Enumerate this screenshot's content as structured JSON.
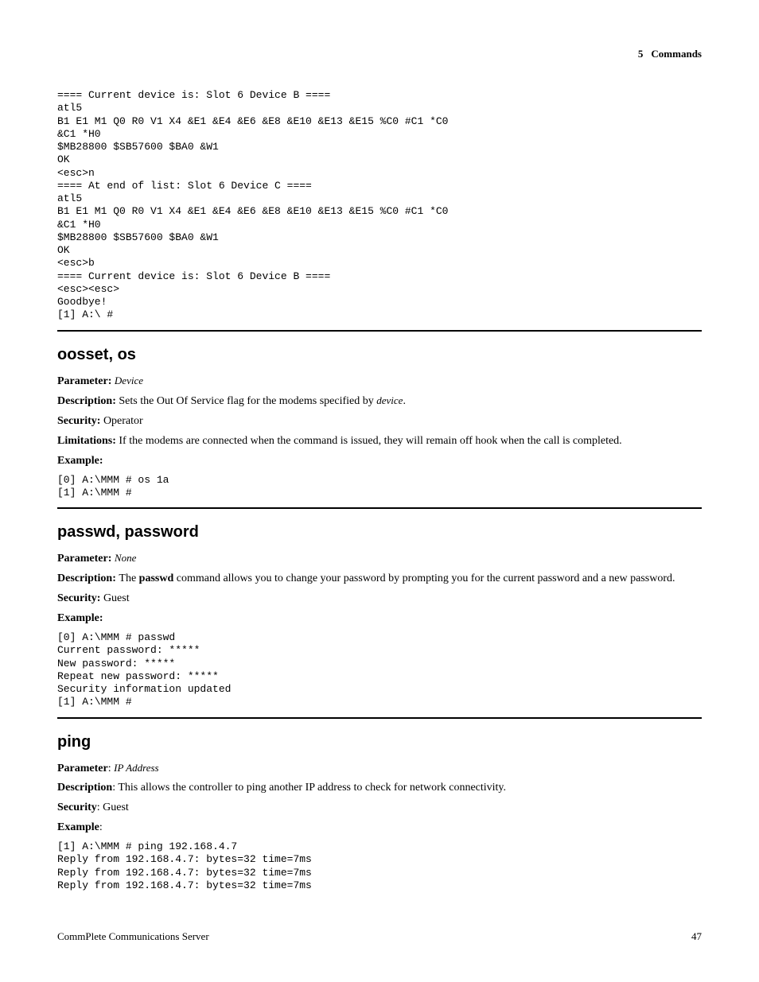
{
  "header": {
    "section_number": "5",
    "section_title": "Commands"
  },
  "intro_code": "==== Current device is: Slot 6 Device B ====\natl5\nB1 E1 M1 Q0 R0 V1 X4 &E1 &E4 &E6 &E8 &E10 &E13 &E15 %C0 #C1 *C0\n&C1 *H0\n$MB28800 $SB57600 $BA0 &W1\nOK\n<esc>n\n==== At end of list: Slot 6 Device C ====\natl5\nB1 E1 M1 Q0 R0 V1 X4 &E1 &E4 &E6 &E8 &E10 &E13 &E15 %C0 #C1 *C0\n&C1 *H0\n$MB28800 $SB57600 $BA0 &W1\nOK\n<esc>b\n==== Current device is: Slot 6 Device B ====\n<esc><esc>\nGoodbye!\n[1] A:\\ #",
  "sections": {
    "oosset": {
      "title": "oosset, os",
      "param_label": "Parameter: ",
      "param_value": "Device",
      "desc_label": "Description: ",
      "desc_pre": "Sets the Out Of Service flag for the modems specified by ",
      "desc_post_ital": "device",
      "desc_end": ".",
      "sec_label": "Security: ",
      "sec_value": "Operator",
      "lim_label": "Limitations: ",
      "lim_value": "If the modems are connected when the command is issued, they will remain off hook when the call is completed.",
      "ex_label": "Example:",
      "ex_code": "[0] A:\\MMM # os 1a\n[1] A:\\MMM #"
    },
    "passwd": {
      "title": "passwd, password",
      "param_label": "Parameter: ",
      "param_value": "None",
      "desc_label": "Description: ",
      "desc_pre": "The ",
      "desc_bold": "passwd",
      "desc_post": " command allows you to change your password by prompting you for the current password and a new password.",
      "sec_label": "Security: ",
      "sec_value": "Guest",
      "ex_label": "Example:",
      "ex_code": "[0] A:\\MMM # passwd\nCurrent password: *****\nNew password: *****\nRepeat new password: *****\nSecurity information updated\n[1] A:\\MMM #"
    },
    "ping": {
      "title": "ping",
      "param_label": "Parameter",
      "param_colon": ": ",
      "param_value": "IP Address",
      "desc_label": "Description",
      "desc_colon": ": ",
      "desc_value": "This allows the controller to ping another IP address to check for network connectivity.",
      "sec_label": "Security",
      "sec_colon": ": ",
      "sec_value": "Guest",
      "ex_label": "Example",
      "ex_colon": ":",
      "ex_code": "[1] A:\\MMM # ping 192.168.4.7\nReply from 192.168.4.7: bytes=32 time=7ms\nReply from 192.168.4.7: bytes=32 time=7ms\nReply from 192.168.4.7: bytes=32 time=7ms"
    }
  },
  "footer": {
    "left": "CommPlete Communications Server",
    "right": "47"
  }
}
